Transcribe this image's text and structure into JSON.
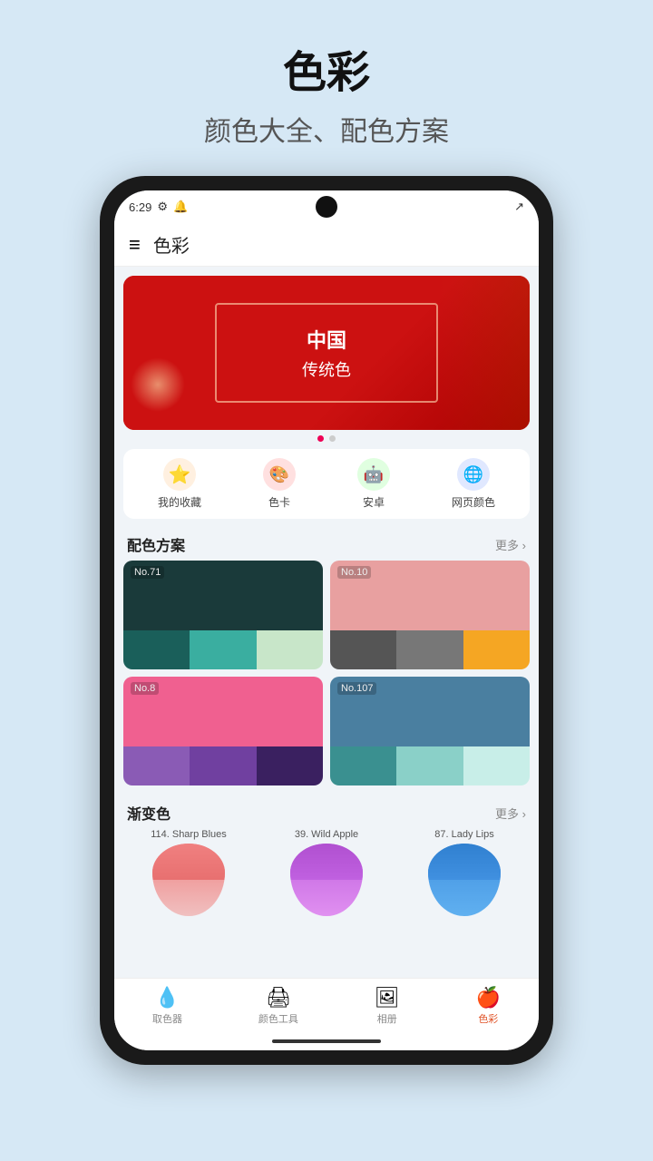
{
  "page": {
    "title": "色彩",
    "subtitle": "颜色大全、配色方案"
  },
  "status_bar": {
    "time": "6:29",
    "icons": [
      "settings-icon",
      "notification-icon",
      "signal-icon"
    ]
  },
  "app_bar": {
    "menu_icon": "≡",
    "title": "色彩"
  },
  "banner": {
    "main_text": "中国",
    "sub_text": "传统色"
  },
  "quick_nav": {
    "items": [
      {
        "id": "favorites",
        "label": "我的收藏",
        "icon": "⭐",
        "color": "#f5a623"
      },
      {
        "id": "palettes",
        "label": "色卡",
        "icon": "🎨",
        "color": "#e74c3c"
      },
      {
        "id": "android",
        "label": "安卓",
        "icon": "🤖",
        "color": "#78c257"
      },
      {
        "id": "web",
        "label": "网页颜色",
        "icon": "🌐",
        "color": "#3498db"
      }
    ]
  },
  "color_scheme": {
    "section_title": "配色方案",
    "more_label": "更多 ›",
    "cards": [
      {
        "id": "card1",
        "label": "No.71",
        "top_color": "#1a3a3a",
        "bottom_colors": [
          "#1a5f5a",
          "#3aaea0",
          "#c8e6c9"
        ]
      },
      {
        "id": "card2",
        "label": "No.10",
        "top_color": "#e8a0a0",
        "bottom_colors": [
          "#555",
          "#777",
          "#f5a623"
        ]
      },
      {
        "id": "card3",
        "label": "No.8",
        "top_color": "#f06090",
        "bottom_colors": [
          "#8a5bb5",
          "#7040a0",
          "#3a2060"
        ]
      },
      {
        "id": "card4",
        "label": "No.107",
        "top_color": "#4a7fa0",
        "bottom_colors": [
          "#3a9090",
          "#8ad0c8",
          "#c8eee8"
        ]
      }
    ]
  },
  "gradients": {
    "section_title": "渐变色",
    "more_label": "更多 ›",
    "items": [
      {
        "id": "grad1",
        "label": "114. Sharp Blues",
        "from": "#f08080",
        "to": "#f0a0a0"
      },
      {
        "id": "grad2",
        "label": "39. Wild Apple",
        "from": "#c060e0",
        "to": "#e090f0"
      },
      {
        "id": "grad3",
        "label": "87. Lady Lips",
        "from": "#4090e0",
        "to": "#60b0f0"
      }
    ]
  },
  "bottom_nav": {
    "items": [
      {
        "id": "picker",
        "label": "取色器",
        "icon": "💧",
        "active": false
      },
      {
        "id": "tools",
        "label": "颜色工具",
        "icon": "🖨",
        "active": false
      },
      {
        "id": "album",
        "label": "相册",
        "icon": "🖼",
        "active": false
      },
      {
        "id": "colors",
        "label": "色彩",
        "icon": "🍎",
        "active": true
      }
    ]
  }
}
